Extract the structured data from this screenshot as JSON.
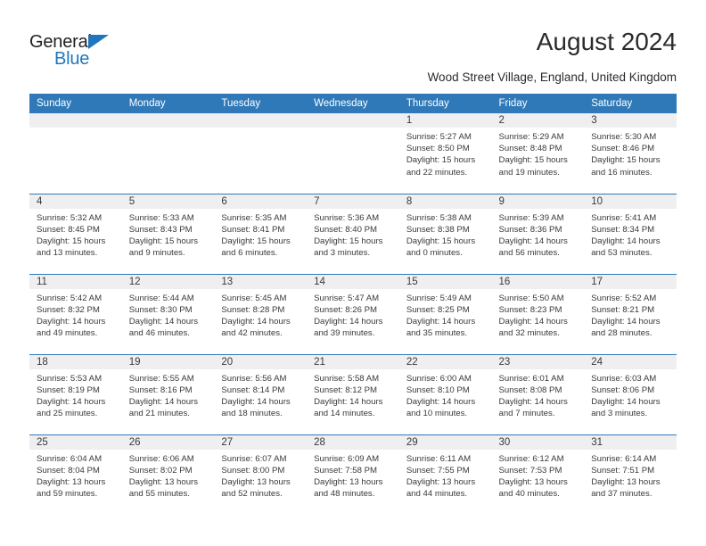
{
  "brand": {
    "name_top": "General",
    "name_bottom": "Blue",
    "accent_color": "#1f76bc"
  },
  "header": {
    "title": "August 2024",
    "subtitle": "Wood Street Village, England, United Kingdom"
  },
  "theme": {
    "header_bar_color": "#3079b8",
    "daynum_bg": "#efefef",
    "text_color": "#3a3a3a"
  },
  "weekday_headers": [
    "Sunday",
    "Monday",
    "Tuesday",
    "Wednesday",
    "Thursday",
    "Friday",
    "Saturday"
  ],
  "weeks": [
    [
      {
        "day": "",
        "sunrise": "",
        "sunset": "",
        "daylight_1": "",
        "daylight_2": ""
      },
      {
        "day": "",
        "sunrise": "",
        "sunset": "",
        "daylight_1": "",
        "daylight_2": ""
      },
      {
        "day": "",
        "sunrise": "",
        "sunset": "",
        "daylight_1": "",
        "daylight_2": ""
      },
      {
        "day": "",
        "sunrise": "",
        "sunset": "",
        "daylight_1": "",
        "daylight_2": ""
      },
      {
        "day": "1",
        "sunrise": "Sunrise: 5:27 AM",
        "sunset": "Sunset: 8:50 PM",
        "daylight_1": "Daylight: 15 hours",
        "daylight_2": "and 22 minutes."
      },
      {
        "day": "2",
        "sunrise": "Sunrise: 5:29 AM",
        "sunset": "Sunset: 8:48 PM",
        "daylight_1": "Daylight: 15 hours",
        "daylight_2": "and 19 minutes."
      },
      {
        "day": "3",
        "sunrise": "Sunrise: 5:30 AM",
        "sunset": "Sunset: 8:46 PM",
        "daylight_1": "Daylight: 15 hours",
        "daylight_2": "and 16 minutes."
      }
    ],
    [
      {
        "day": "4",
        "sunrise": "Sunrise: 5:32 AM",
        "sunset": "Sunset: 8:45 PM",
        "daylight_1": "Daylight: 15 hours",
        "daylight_2": "and 13 minutes."
      },
      {
        "day": "5",
        "sunrise": "Sunrise: 5:33 AM",
        "sunset": "Sunset: 8:43 PM",
        "daylight_1": "Daylight: 15 hours",
        "daylight_2": "and 9 minutes."
      },
      {
        "day": "6",
        "sunrise": "Sunrise: 5:35 AM",
        "sunset": "Sunset: 8:41 PM",
        "daylight_1": "Daylight: 15 hours",
        "daylight_2": "and 6 minutes."
      },
      {
        "day": "7",
        "sunrise": "Sunrise: 5:36 AM",
        "sunset": "Sunset: 8:40 PM",
        "daylight_1": "Daylight: 15 hours",
        "daylight_2": "and 3 minutes."
      },
      {
        "day": "8",
        "sunrise": "Sunrise: 5:38 AM",
        "sunset": "Sunset: 8:38 PM",
        "daylight_1": "Daylight: 15 hours",
        "daylight_2": "and 0 minutes."
      },
      {
        "day": "9",
        "sunrise": "Sunrise: 5:39 AM",
        "sunset": "Sunset: 8:36 PM",
        "daylight_1": "Daylight: 14 hours",
        "daylight_2": "and 56 minutes."
      },
      {
        "day": "10",
        "sunrise": "Sunrise: 5:41 AM",
        "sunset": "Sunset: 8:34 PM",
        "daylight_1": "Daylight: 14 hours",
        "daylight_2": "and 53 minutes."
      }
    ],
    [
      {
        "day": "11",
        "sunrise": "Sunrise: 5:42 AM",
        "sunset": "Sunset: 8:32 PM",
        "daylight_1": "Daylight: 14 hours",
        "daylight_2": "and 49 minutes."
      },
      {
        "day": "12",
        "sunrise": "Sunrise: 5:44 AM",
        "sunset": "Sunset: 8:30 PM",
        "daylight_1": "Daylight: 14 hours",
        "daylight_2": "and 46 minutes."
      },
      {
        "day": "13",
        "sunrise": "Sunrise: 5:45 AM",
        "sunset": "Sunset: 8:28 PM",
        "daylight_1": "Daylight: 14 hours",
        "daylight_2": "and 42 minutes."
      },
      {
        "day": "14",
        "sunrise": "Sunrise: 5:47 AM",
        "sunset": "Sunset: 8:26 PM",
        "daylight_1": "Daylight: 14 hours",
        "daylight_2": "and 39 minutes."
      },
      {
        "day": "15",
        "sunrise": "Sunrise: 5:49 AM",
        "sunset": "Sunset: 8:25 PM",
        "daylight_1": "Daylight: 14 hours",
        "daylight_2": "and 35 minutes."
      },
      {
        "day": "16",
        "sunrise": "Sunrise: 5:50 AM",
        "sunset": "Sunset: 8:23 PM",
        "daylight_1": "Daylight: 14 hours",
        "daylight_2": "and 32 minutes."
      },
      {
        "day": "17",
        "sunrise": "Sunrise: 5:52 AM",
        "sunset": "Sunset: 8:21 PM",
        "daylight_1": "Daylight: 14 hours",
        "daylight_2": "and 28 minutes."
      }
    ],
    [
      {
        "day": "18",
        "sunrise": "Sunrise: 5:53 AM",
        "sunset": "Sunset: 8:19 PM",
        "daylight_1": "Daylight: 14 hours",
        "daylight_2": "and 25 minutes."
      },
      {
        "day": "19",
        "sunrise": "Sunrise: 5:55 AM",
        "sunset": "Sunset: 8:16 PM",
        "daylight_1": "Daylight: 14 hours",
        "daylight_2": "and 21 minutes."
      },
      {
        "day": "20",
        "sunrise": "Sunrise: 5:56 AM",
        "sunset": "Sunset: 8:14 PM",
        "daylight_1": "Daylight: 14 hours",
        "daylight_2": "and 18 minutes."
      },
      {
        "day": "21",
        "sunrise": "Sunrise: 5:58 AM",
        "sunset": "Sunset: 8:12 PM",
        "daylight_1": "Daylight: 14 hours",
        "daylight_2": "and 14 minutes."
      },
      {
        "day": "22",
        "sunrise": "Sunrise: 6:00 AM",
        "sunset": "Sunset: 8:10 PM",
        "daylight_1": "Daylight: 14 hours",
        "daylight_2": "and 10 minutes."
      },
      {
        "day": "23",
        "sunrise": "Sunrise: 6:01 AM",
        "sunset": "Sunset: 8:08 PM",
        "daylight_1": "Daylight: 14 hours",
        "daylight_2": "and 7 minutes."
      },
      {
        "day": "24",
        "sunrise": "Sunrise: 6:03 AM",
        "sunset": "Sunset: 8:06 PM",
        "daylight_1": "Daylight: 14 hours",
        "daylight_2": "and 3 minutes."
      }
    ],
    [
      {
        "day": "25",
        "sunrise": "Sunrise: 6:04 AM",
        "sunset": "Sunset: 8:04 PM",
        "daylight_1": "Daylight: 13 hours",
        "daylight_2": "and 59 minutes."
      },
      {
        "day": "26",
        "sunrise": "Sunrise: 6:06 AM",
        "sunset": "Sunset: 8:02 PM",
        "daylight_1": "Daylight: 13 hours",
        "daylight_2": "and 55 minutes."
      },
      {
        "day": "27",
        "sunrise": "Sunrise: 6:07 AM",
        "sunset": "Sunset: 8:00 PM",
        "daylight_1": "Daylight: 13 hours",
        "daylight_2": "and 52 minutes."
      },
      {
        "day": "28",
        "sunrise": "Sunrise: 6:09 AM",
        "sunset": "Sunset: 7:58 PM",
        "daylight_1": "Daylight: 13 hours",
        "daylight_2": "and 48 minutes."
      },
      {
        "day": "29",
        "sunrise": "Sunrise: 6:11 AM",
        "sunset": "Sunset: 7:55 PM",
        "daylight_1": "Daylight: 13 hours",
        "daylight_2": "and 44 minutes."
      },
      {
        "day": "30",
        "sunrise": "Sunrise: 6:12 AM",
        "sunset": "Sunset: 7:53 PM",
        "daylight_1": "Daylight: 13 hours",
        "daylight_2": "and 40 minutes."
      },
      {
        "day": "31",
        "sunrise": "Sunrise: 6:14 AM",
        "sunset": "Sunset: 7:51 PM",
        "daylight_1": "Daylight: 13 hours",
        "daylight_2": "and 37 minutes."
      }
    ]
  ]
}
